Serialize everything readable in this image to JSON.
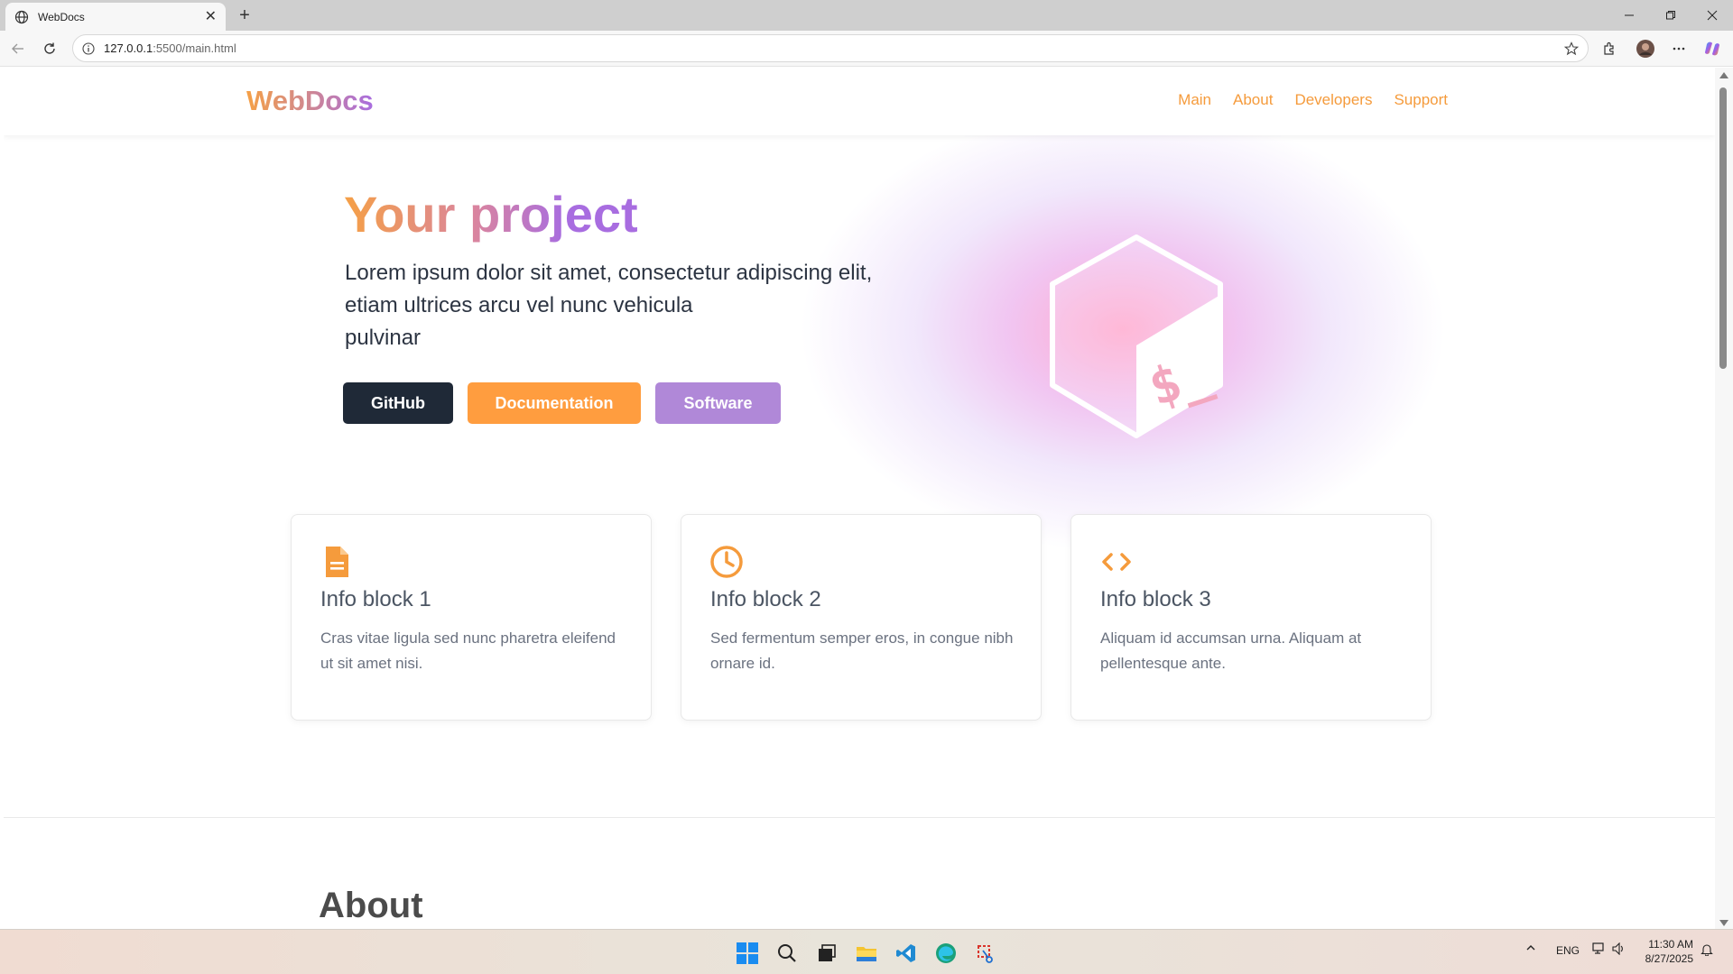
{
  "browser": {
    "tab_title": "WebDocs",
    "url_host": "127.0.0.1",
    "url_rest": ":5500/main.html"
  },
  "site": {
    "logo": "WebDocs",
    "nav": [
      "Main",
      "About",
      "Developers",
      "Support"
    ]
  },
  "hero": {
    "title": "Your project",
    "text_line1": "Lorem ipsum dolor sit amet, consectetur adipiscing elit,",
    "text_line2": "etiam ultrices arcu vel nunc vehicula",
    "text_line3": "pulvinar",
    "buttons": {
      "github": "GitHub",
      "docs": "Documentation",
      "software": "Software"
    }
  },
  "cards": [
    {
      "title": "Info block 1",
      "text": "Cras vitae ligula sed nunc pharetra eleifend ut sit amet nisi.",
      "icon": "document-icon"
    },
    {
      "title": "Info block 2",
      "text": "Sed fermentum semper eros, in congue nibh ornare id.",
      "icon": "clock-icon"
    },
    {
      "title": "Info block 3",
      "text": "Aliquam id accumsan urna. Aliquam at pellentesque ante.",
      "icon": "code-icon"
    }
  ],
  "about": {
    "title": "About"
  },
  "taskbar": {
    "lang": "ENG",
    "time": "11:30 AM",
    "date": "8/27/2025"
  },
  "colors": {
    "accent_orange": "#ff9d3f",
    "accent_purple": "#b088d8",
    "dark": "#1f2937"
  }
}
